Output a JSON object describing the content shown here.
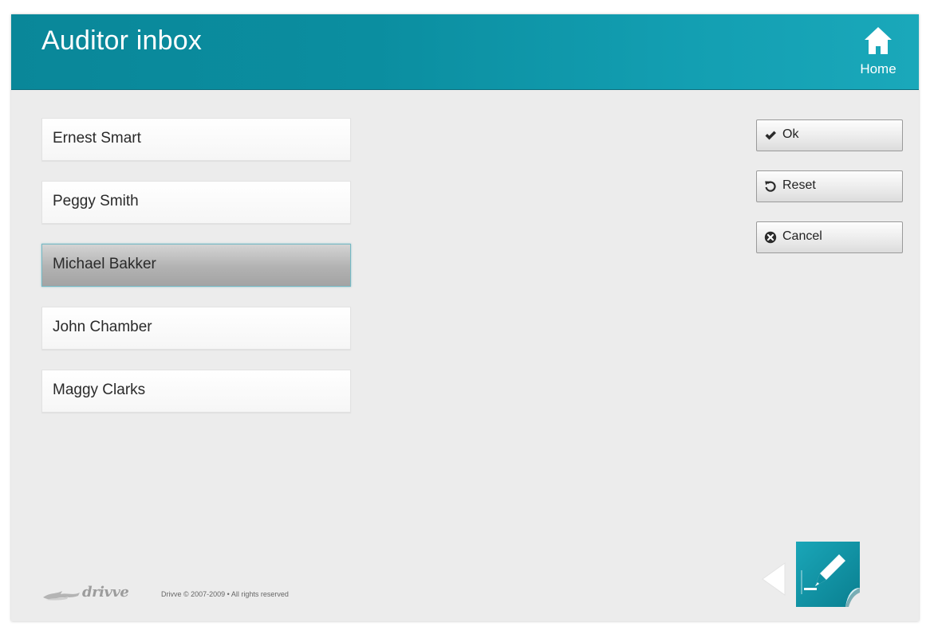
{
  "app": {
    "title": "Auditor inbox"
  },
  "header": {
    "home_label": "Home",
    "home_icon": "home-icon"
  },
  "users": [
    {
      "name": "Ernest Smart",
      "selected": false
    },
    {
      "name": "Peggy Smith",
      "selected": false
    },
    {
      "name": "Michael Bakker",
      "selected": true
    },
    {
      "name": "John Chamber",
      "selected": false
    },
    {
      "name": "Maggy Clarks",
      "selected": false
    }
  ],
  "actions": {
    "ok_label": "Ok",
    "ok_icon": "checkmark-icon",
    "reset_label": "Reset",
    "reset_icon": "reset-icon",
    "cancel_label": "Cancel",
    "cancel_icon": "cancel-icon"
  },
  "footer": {
    "logo_text": "drivve",
    "copyright": "Drivve © 2007-2009 • All rights reserved"
  },
  "colors": {
    "header": "#0b8ea0",
    "selected_item": "#b2b2b2",
    "background": "#ececec"
  }
}
